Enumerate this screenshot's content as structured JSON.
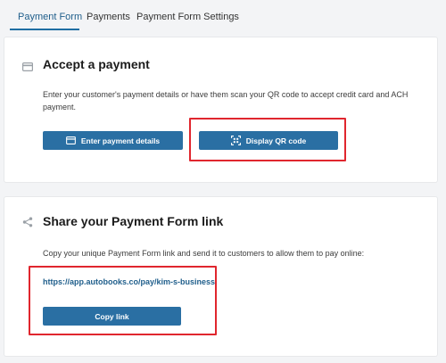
{
  "tabs": [
    {
      "label": "Payment Form",
      "active": true
    },
    {
      "label": "Payments",
      "active": false
    },
    {
      "label": "Payment Form Settings",
      "active": false
    }
  ],
  "accept_payment": {
    "icon": "card-icon",
    "title": "Accept a payment",
    "description": "Enter your customer's payment details or have them scan your QR code to accept credit card and ACH payment.",
    "enter_details_button": {
      "label": "Enter payment details",
      "icon": "card-icon"
    },
    "qr_button": {
      "label": "Display QR code",
      "icon": "qr-code-icon"
    }
  },
  "share_link": {
    "icon": "share-icon",
    "title": "Share your Payment Form link",
    "description": "Copy your unique Payment Form link and send it to customers to allow them to pay online:",
    "url": "https://app.autobooks.co/pay/kim-s-business",
    "copy_button": {
      "label": "Copy link"
    }
  },
  "colors": {
    "accent": "#2a6fa3",
    "highlight": "#e0262e",
    "background": "#f3f4f6"
  }
}
